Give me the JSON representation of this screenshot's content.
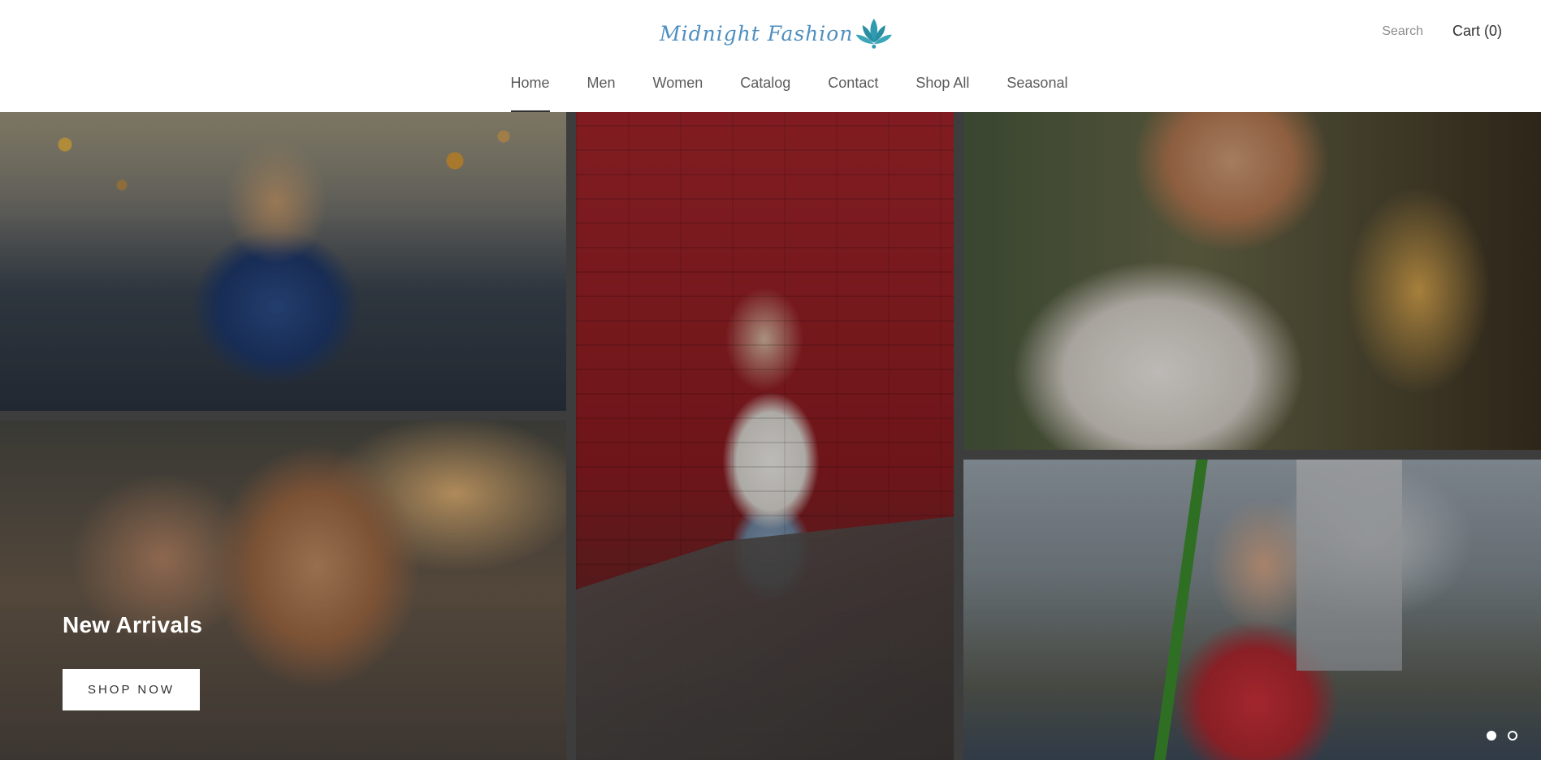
{
  "brand": {
    "logo_text": "Midnight Fashion",
    "logo_color": "#4f8fc0",
    "lotus_color": "#2f9bb0",
    "logo_icon": "lotus-icon"
  },
  "header": {
    "search_label": "Search",
    "cart_label": "Cart (0)"
  },
  "nav": {
    "items": [
      {
        "label": "Home",
        "active": true
      },
      {
        "label": "Men"
      },
      {
        "label": "Women"
      },
      {
        "label": "Catalog"
      },
      {
        "label": "Contact"
      },
      {
        "label": "Shop All"
      },
      {
        "label": "Seasonal"
      }
    ]
  },
  "hero": {
    "title": "New Arrivals",
    "button_label": "SHOP NOW",
    "slides": 2,
    "active_slide": 1
  }
}
